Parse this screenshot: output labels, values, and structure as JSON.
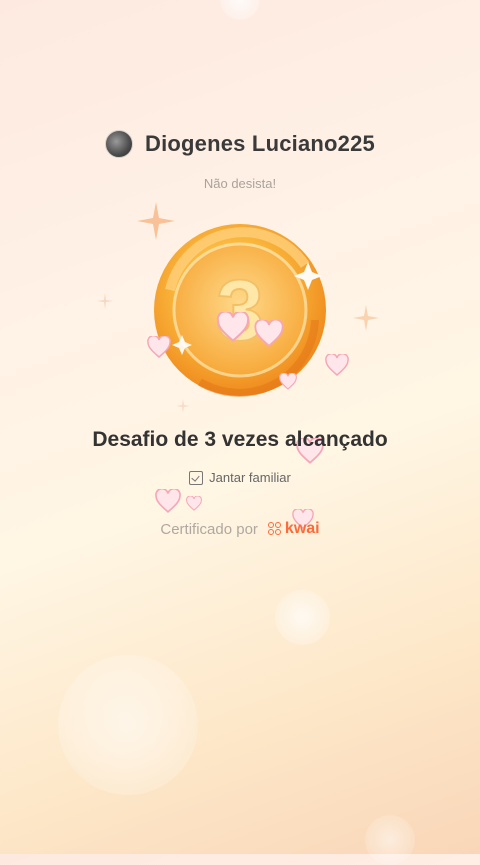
{
  "header": {
    "username": "Diogenes Luciano225",
    "subtitle": "Não desista!"
  },
  "medal": {
    "number": "3",
    "icon": "medal-number-icon"
  },
  "achievement": {
    "title": "Desafio de 3 vezes alcançado",
    "tag": "Jantar familiar"
  },
  "certification": {
    "label": "Certificado por",
    "brand": "kwai"
  },
  "colors": {
    "accent": "#ff6a3a",
    "gold": "#f6a623",
    "text": "#333333"
  }
}
